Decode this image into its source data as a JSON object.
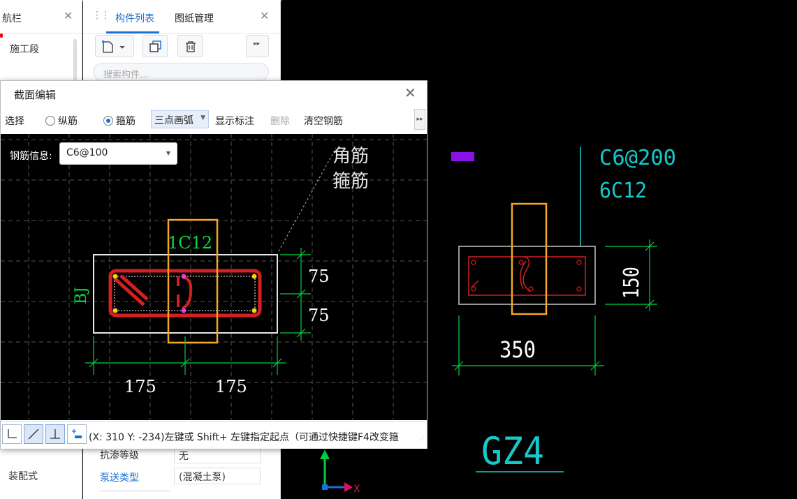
{
  "nav_panel": {
    "title": "航栏",
    "item_construction": "施工段",
    "item_prefab": "装配式"
  },
  "comp_panel": {
    "tab_components": "构件列表",
    "tab_drawings": "图纸管理",
    "search_placeholder": "搜索构件...",
    "props": [
      {
        "label": "抗渗等级",
        "value": "无"
      },
      {
        "label": "泵送类型",
        "value": "(混凝土泵)"
      }
    ]
  },
  "dialog": {
    "title": "截面编辑",
    "toolbar": {
      "select": "选择",
      "longitudinal": "纵筋",
      "stirrup": "箍筋",
      "arc_mode": "三点画弧",
      "show_dims": "显示标注",
      "delete": "删除",
      "clear_rebar": "清空钢筋"
    },
    "rebar_info_label": "钢筋信息:",
    "rebar_info_value": "C6@100",
    "canvas": {
      "label_corner": "角筋",
      "label_stirrup": "箍筋",
      "label_top": "1C12",
      "label_side": "BJ",
      "dim_v1": "75",
      "dim_v2": "75",
      "dim_h1": "175",
      "dim_h2": "175"
    },
    "status_text": "(X: 310 Y: -234)左键或 Shift+ 左键指定起点（可通过快捷键F4改变箍"
  },
  "main_canvas": {
    "label_stirrup": "C6@200",
    "label_main": "6C12",
    "dim_height": "150",
    "dim_width": "350",
    "component_name": "GZ4",
    "axis_x": "X"
  },
  "colors": {
    "accent": "#1a6fd6",
    "rebar": "#d42020",
    "dim_green": "#00d040",
    "cyan": "#18c8c8",
    "highlight": "#f5a623"
  }
}
